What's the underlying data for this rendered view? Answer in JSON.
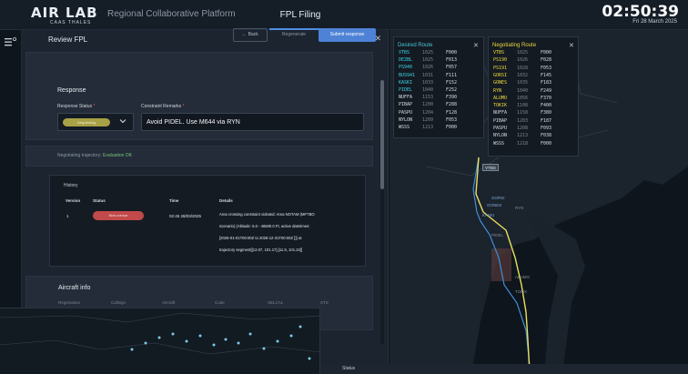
{
  "header": {
    "logo": "AIR LAB",
    "logo_sub": "CAAS THALES",
    "app_title": "Regional Collaborative Platform",
    "active_tab": "FPL Filing",
    "clock": "02:50:39",
    "date": "Fri 28 March 2025"
  },
  "review": {
    "title": "Review FPL",
    "back_label": "← Back",
    "regenerate_label": "Regenerate",
    "submit_label": "Submit response",
    "response_title": "Response",
    "status_label": "Response Status",
    "status_required": "*",
    "status_value": "Negotiating",
    "remarks_label": "Constraint Remarks",
    "remarks_required": "*",
    "remarks_value": "Avoid PIDEL. Use M644 via RYN",
    "trajectory_prefix": "Negotiating trajectory:",
    "trajectory_status": "Evaluation OK",
    "history": {
      "title": "History",
      "columns": [
        "Version",
        "Status",
        "Time",
        "Details"
      ],
      "row": {
        "version": "1",
        "status": "Non-concur",
        "time": "02:46 28/03/2025",
        "details": [
          "Area crossing constraint violated: Area NOTAM (MFTBO",
          "scenario) (Altitude: 5.0 - 46500.0 Ft, active datetimes:",
          "[2025-01-01T00:00Z to 2026-12-31T00:00Z ]]) at",
          "trajectory segment[[12.07, 101.17],[11.9, 101.22]]"
        ]
      }
    },
    "aircraft_title": "Aircraft info",
    "aircraft_columns": [
      "Registration",
      "Callsign",
      "Aircraft",
      "Code",
      "SELCAL",
      "STS"
    ]
  },
  "desired_route": {
    "title": "Desired Route",
    "rows": [
      [
        "VTBS",
        "1025",
        "F000"
      ],
      [
        "DEZBL",
        "1025",
        "F013"
      ],
      [
        "PS940",
        "1026",
        "F057"
      ],
      [
        "BUS941",
        "1031",
        "F111"
      ],
      [
        "KASKI",
        "1033",
        "F152"
      ],
      [
        "PIDEL",
        "1040",
        "F252"
      ],
      [
        "NUFFA",
        "1153",
        "F390"
      ],
      [
        "PIBAP",
        "1200",
        "F288"
      ],
      [
        "PASPU",
        "1204",
        "F128"
      ],
      [
        "NYLON",
        "1209",
        "F053"
      ],
      [
        "WSSS",
        "1213",
        "F000"
      ]
    ]
  },
  "negotiating_route": {
    "title": "Negotiating Route",
    "rows": [
      [
        "VTBS",
        "1025",
        "F000"
      ],
      [
        "PS190",
        "1026",
        "F028"
      ],
      [
        "PS191",
        "1028",
        "F053"
      ],
      [
        "GORSI",
        "1032",
        "F145"
      ],
      [
        "GONES",
        "1035",
        "F183"
      ],
      [
        "RYN",
        "1040",
        "F249"
      ],
      [
        "ALUMO",
        "1056",
        "F370"
      ],
      [
        "TOKIK",
        "1108",
        "F400"
      ],
      [
        "NUFFA",
        "1158",
        "F380"
      ],
      [
        "PIBAP",
        "1203",
        "F187"
      ],
      [
        "PASPU",
        "1208",
        "F093"
      ],
      [
        "NYLON",
        "1213",
        "F038"
      ],
      [
        "WSSS",
        "1218",
        "F000"
      ]
    ]
  },
  "map_labels": {
    "vtbs": "VTBS",
    "waypoints": [
      "GORSI",
      "GONES",
      "KASKI",
      "RYN",
      "PIDEL",
      "ALUMO",
      "TOKIK"
    ]
  },
  "status_bar": {
    "label": "Status"
  }
}
